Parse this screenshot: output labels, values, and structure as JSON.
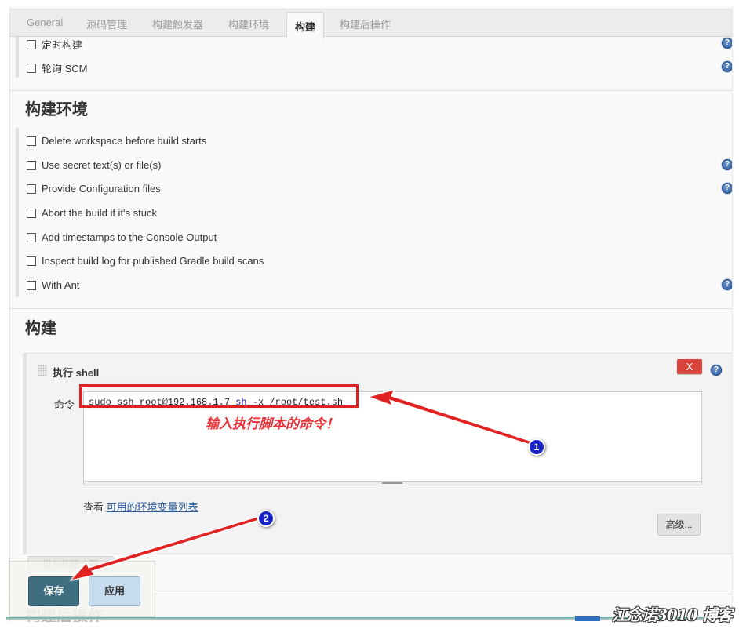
{
  "tabs": [
    {
      "label": "General",
      "active": false
    },
    {
      "label": "源码管理",
      "active": false
    },
    {
      "label": "构建触发器",
      "active": false
    },
    {
      "label": "构建环境",
      "active": false
    },
    {
      "label": "构建",
      "active": true
    },
    {
      "label": "构建后操作",
      "active": false
    }
  ],
  "triggers": {
    "items": [
      {
        "label": "定时构建",
        "checked": false
      },
      {
        "label": "轮询 SCM",
        "checked": false
      }
    ]
  },
  "build_env": {
    "title": "构建环境",
    "items": [
      {
        "label": "Delete workspace before build starts",
        "checked": false
      },
      {
        "label": "Use secret text(s) or file(s)",
        "checked": false
      },
      {
        "label": "Provide Configuration files",
        "checked": false
      },
      {
        "label": "Abort the build if it's stuck",
        "checked": false
      },
      {
        "label": "Add timestamps to the Console Output",
        "checked": false
      },
      {
        "label": "Inspect build log for published Gradle build scans",
        "checked": false
      },
      {
        "label": "With Ant",
        "checked": false
      }
    ]
  },
  "build": {
    "title": "构建",
    "step": {
      "title": "执行 shell",
      "delete_label": "X",
      "command_label": "命令",
      "command_parts": {
        "p1": "sudo ssh root@192.168.1.7 ",
        "p2": "sh",
        "p3": " -x /root/test.sh"
      },
      "env_prefix": "查看",
      "env_link": "可用的环境变量列表",
      "advanced_label": "高级..."
    },
    "add_step_label": "增加构建步骤"
  },
  "post_build": {
    "title": "构建后操作"
  },
  "actions": {
    "save_label": "保存",
    "apply_label": "应用"
  },
  "annotations": {
    "note": "输入执行脚本的命令！",
    "badge1": "1",
    "badge2": "2",
    "arrow_color": "#e02020",
    "badge_color": "#1b24c9"
  },
  "help_icon_glyph": "?",
  "watermark": "江念诺3010 博客"
}
